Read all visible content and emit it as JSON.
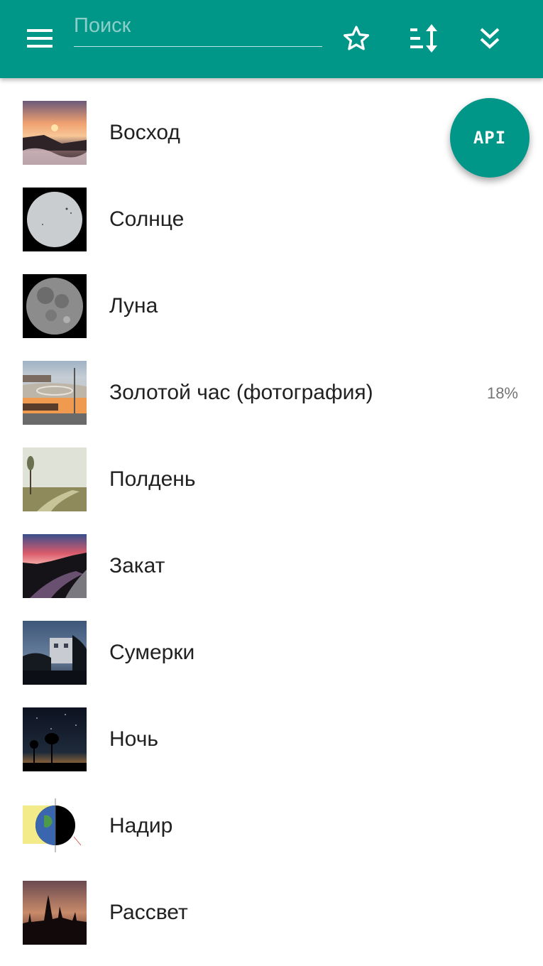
{
  "header": {
    "menu_icon": "hamburger-menu-icon",
    "search": {
      "placeholder": "Поиск",
      "value": ""
    },
    "actions": [
      {
        "icon": "star-outline-icon"
      },
      {
        "icon": "sort-icon"
      },
      {
        "icon": "double-chevron-down-icon"
      }
    ],
    "background": "#009688"
  },
  "fab": {
    "label": "API",
    "color": "#009688"
  },
  "items": [
    {
      "label": "Восход",
      "badge": ""
    },
    {
      "label": "Солнце",
      "badge": ""
    },
    {
      "label": "Луна",
      "badge": ""
    },
    {
      "label": "Золотой час (фотография)",
      "badge": "18%"
    },
    {
      "label": "Полдень",
      "badge": ""
    },
    {
      "label": "Закат",
      "badge": ""
    },
    {
      "label": "Сумерки",
      "badge": ""
    },
    {
      "label": "Ночь",
      "badge": ""
    },
    {
      "label": "Надир",
      "badge": ""
    },
    {
      "label": "Рассвет",
      "badge": ""
    }
  ]
}
